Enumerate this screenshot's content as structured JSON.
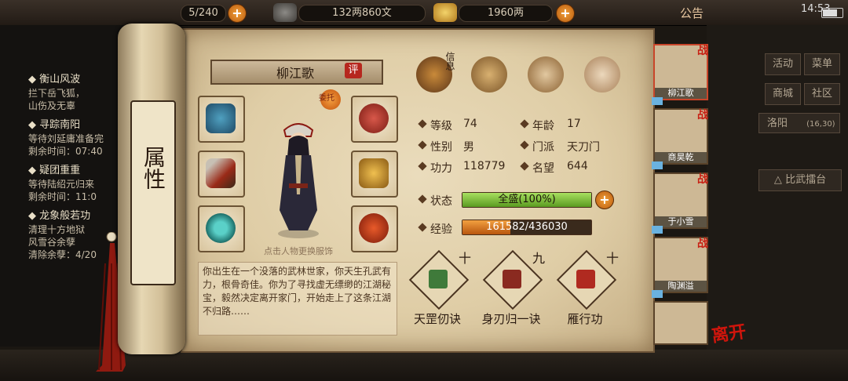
{
  "topbar": {
    "bag_count": "5/240",
    "money": "132两860文",
    "gold": "1960两",
    "notice_label": "公告",
    "clock": "14:53"
  },
  "quests": [
    {
      "title": "衡山风波",
      "line1": "拦下岳飞狐，",
      "line2": "山伤及无辜"
    },
    {
      "title": "寻踪南阳",
      "line1": "等待刘延庸准备完",
      "line2": "剩余时间：07:40"
    },
    {
      "title": "疑团重重",
      "line1": "等待陆绍元归来",
      "line2": "剩余时间：11:0"
    },
    {
      "title": "龙象般若功",
      "line1": "清理十方地狱",
      "line2": "风雪谷余孽",
      "line3": "清除余孽：4/20"
    }
  ],
  "right_menu": {
    "activity": "活动",
    "menu": "菜单",
    "shop": "商城",
    "community": "社区",
    "location": "洛阳",
    "coords": "(16,30)",
    "arena": "比武擂台"
  },
  "character": {
    "attr_tab": "属性",
    "name": "柳江歌",
    "rate_button": "评",
    "entrust": "委托",
    "hint": "点击人物更换服饰",
    "info_label": "信息",
    "bio": "你出生在一个没落的武林世家，你天生孔武有力，根骨奇佳。你为了寻找虚无缥缈的江湖秘宝，毅然决定离开家门，开始走上了这条江湖不归路……",
    "stats": {
      "level_label": "等级",
      "level": "74",
      "age_label": "年龄",
      "age": "17",
      "gender_label": "性别",
      "gender": "男",
      "sect_label": "门派",
      "sect": "天刀门",
      "power_label": "功力",
      "power": "118779",
      "fame_label": "名望",
      "fame": "644",
      "state_label": "状态",
      "state_text": "全盛(100%)",
      "state_pct": 100,
      "exp_label": "经验",
      "exp_text": "161582/436030",
      "exp_pct": 37
    }
  },
  "skills": [
    {
      "name": "天罡仞诀",
      "level": "十"
    },
    {
      "name": "身刃归一诀",
      "level": "九"
    },
    {
      "name": "雁行功",
      "level": "十"
    }
  ],
  "party": [
    {
      "name": "柳江歌",
      "badge": "战"
    },
    {
      "name": "商昊乾",
      "badge": "战"
    },
    {
      "name": "于小雪",
      "badge": "战"
    },
    {
      "name": "陶渊溢",
      "badge": "战"
    },
    {
      "name": "",
      "badge": ""
    }
  ],
  "leave_button": "离开",
  "colors": {
    "accent": "#b6271e",
    "state_bar": "#7ec33a",
    "exp_bar": "#e07a18"
  }
}
